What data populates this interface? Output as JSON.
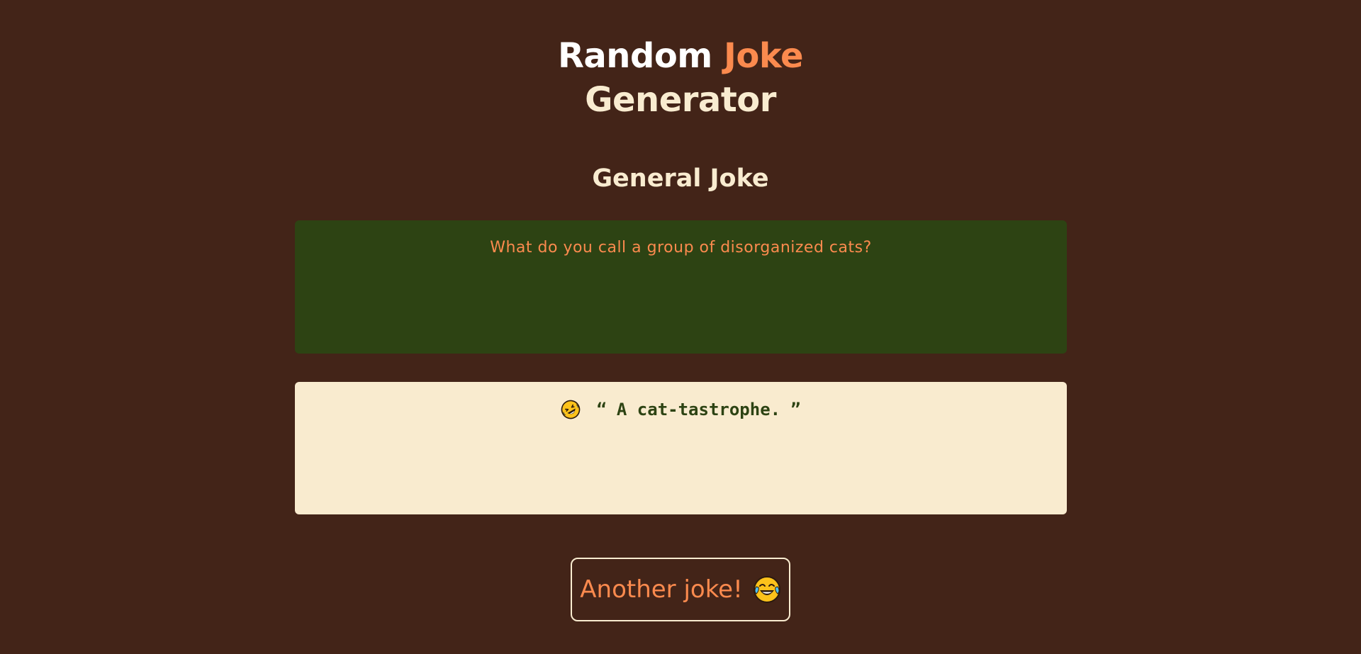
{
  "title": {
    "part1": "Random",
    "accent": "Joke",
    "line2": "Generator"
  },
  "category": "General Joke",
  "joke": {
    "setup": "What do you call a group of disorganized cats?",
    "open_quote": "“",
    "punchline": "A cat-tastrophe.",
    "close_quote": "”"
  },
  "button": {
    "label": "Another joke!"
  },
  "colors": {
    "background": "#432418",
    "accent": "#fb8a4e",
    "cream": "#f9ecd0",
    "green": "#2d4313"
  },
  "icons": {
    "punchline_icon": "rolling-on-floor-laughing-icon",
    "button_icon": "tears-of-joy-icon"
  }
}
